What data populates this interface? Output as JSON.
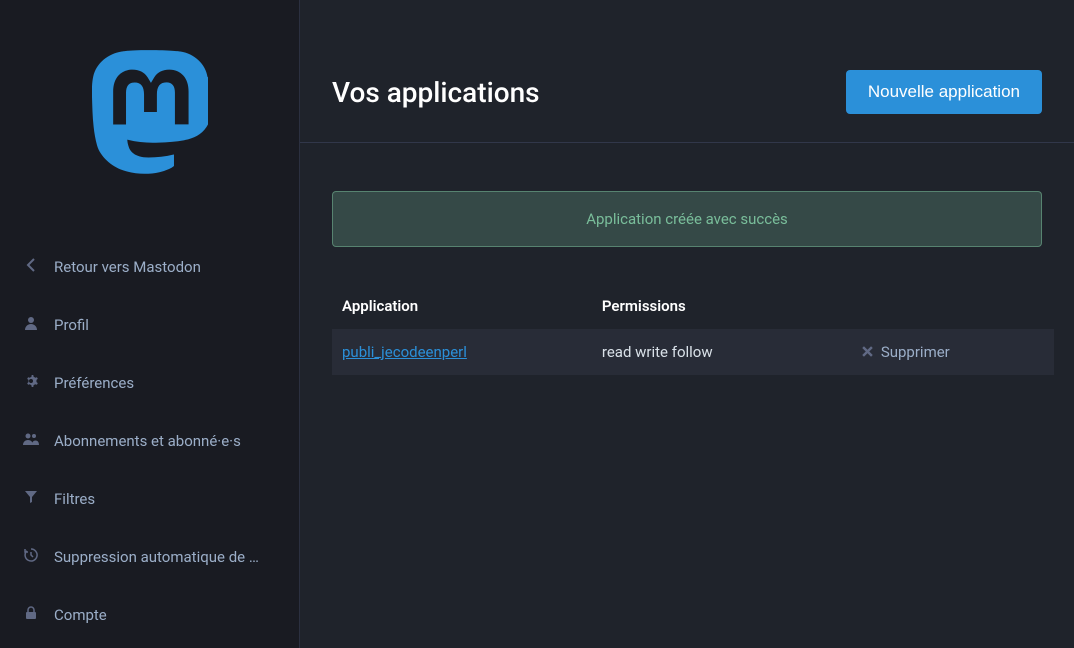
{
  "sidebar": {
    "items": [
      {
        "label": "Retour vers Mastodon"
      },
      {
        "label": "Profil"
      },
      {
        "label": "Préférences"
      },
      {
        "label": "Abonnements et abonné·e·s"
      },
      {
        "label": "Filtres"
      },
      {
        "label": "Suppression automatique de …"
      },
      {
        "label": "Compte"
      }
    ]
  },
  "main": {
    "title": "Vos applications",
    "new_button": "Nouvelle application",
    "flash": "Application créée avec succès",
    "table": {
      "col_application": "Application",
      "col_permissions": "Permissions",
      "rows": [
        {
          "name": "publi_jecodeenperl",
          "permissions": "read write follow",
          "delete_label": "Supprimer"
        }
      ]
    }
  }
}
